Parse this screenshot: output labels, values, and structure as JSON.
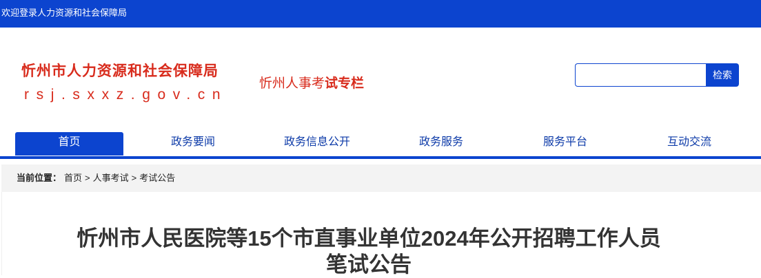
{
  "topbar": {
    "welcome": "欢迎登录人力资源和社会保障局"
  },
  "logo": {
    "title": "忻州市人力资源和社会保障局",
    "domain": "rsj.sxxz.gov.cn"
  },
  "column_link": {
    "part_a": "忻州人事考",
    "part_b": "试专栏"
  },
  "search": {
    "placeholder": "",
    "button_label": "检索"
  },
  "nav": {
    "items": [
      {
        "label": "首页"
      },
      {
        "label": "政务要闻"
      },
      {
        "label": "政务信息公开"
      },
      {
        "label": "政务服务"
      },
      {
        "label": "服务平台"
      },
      {
        "label": "互动交流"
      }
    ]
  },
  "breadcrumb": {
    "label": "当前位置：",
    "items": [
      "首页",
      "人事考试",
      "考试公告"
    ],
    "separator": ">"
  },
  "article": {
    "title_line1": "忻州市人民医院等15个市直事业单位2024年公开招聘工作人员",
    "title_line2": "笔试公告"
  },
  "colors": {
    "primary": "#0c44cf",
    "brand_red": "#d82b1c",
    "breadcrumb_bg": "#f3f3f3"
  }
}
